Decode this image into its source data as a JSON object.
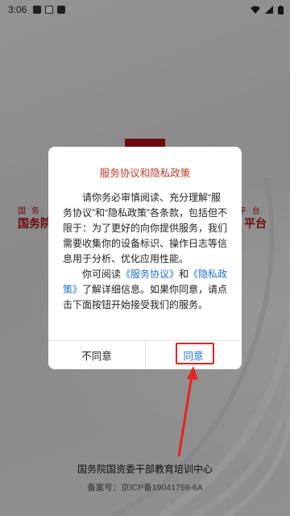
{
  "status_bar": {
    "time": "3:06"
  },
  "background": {
    "subtitle_left": "国 务",
    "subtitle_right": "平 台",
    "title_left": "国务院",
    "title_right": "平台"
  },
  "dialog": {
    "title": "服务协议和隐私政策",
    "paragraph1": "请你务必审慎阅读、充分理解“服务协议”和“隐私政策”各条款，包括但不限于：为了更好的向你提供服务，我们需要收集你的设备标识、操作日志等信息用于分析、优化应用性能。",
    "paragraph2_prefix": "你可阅读",
    "link_service": "《服务协议》",
    "paragraph2_and": "和",
    "link_privacy": "《隐私政策》",
    "paragraph2_suffix": "了解详细信息。如果你同意，请点击下面按钮开始接受我们的服务。",
    "disagree_label": "不同意",
    "agree_label": "同意"
  },
  "footer": {
    "organization": "国务院国资委干部教育培训中心",
    "icp": "备案号：京ICP备19041759-6A"
  },
  "colors": {
    "brand_red": "#b3121a",
    "link_blue": "#1e6fd9",
    "annotation_red": "#e8231f"
  }
}
